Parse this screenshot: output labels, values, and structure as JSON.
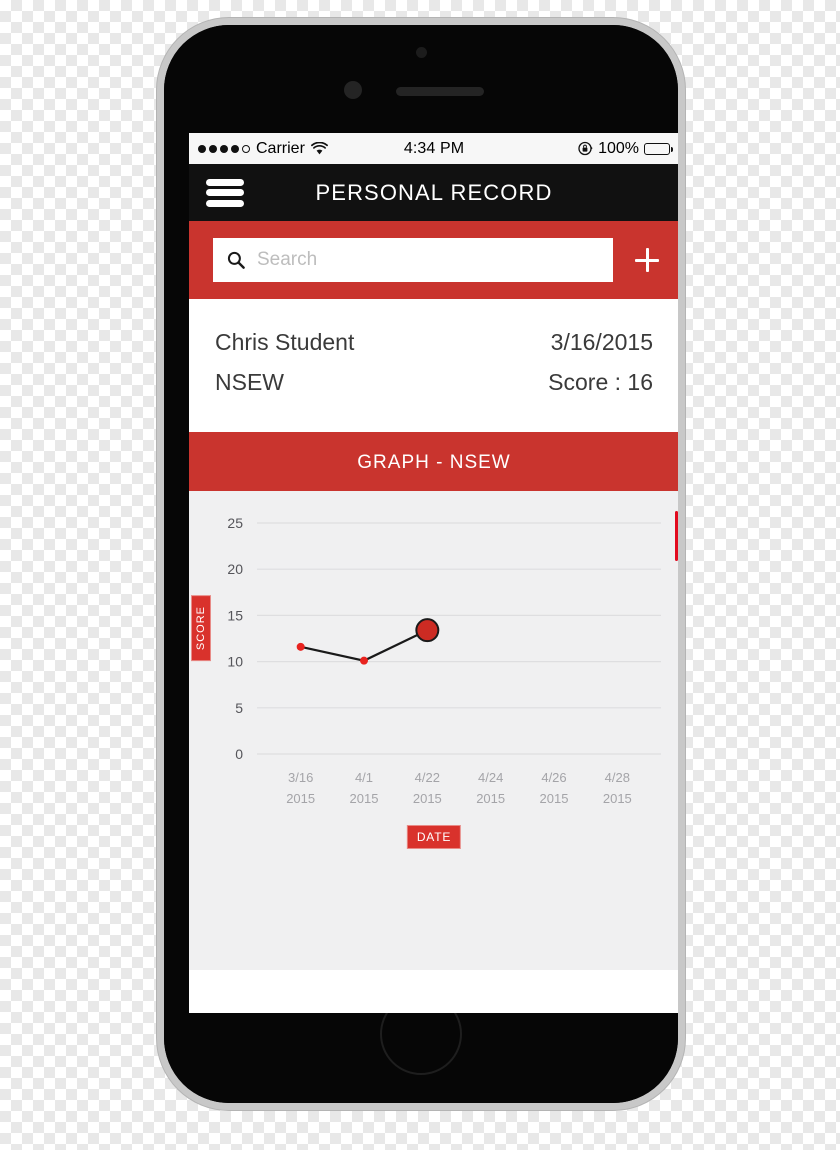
{
  "device": {
    "name": "iphone-mockup",
    "frame_color": "#c8c8c8",
    "body_color": "#0a0a0a"
  },
  "status_bar": {
    "signal_dots_filled": 4,
    "signal_dots_total": 5,
    "carrier": "Carrier",
    "wifi_icon": "wifi-icon",
    "time": "4:34 PM",
    "rotation_lock_icon": "rotation-lock-icon",
    "battery_percent": "100%",
    "battery_level": 100
  },
  "nav": {
    "menu_icon": "hamburger-menu-icon",
    "title": "PERSONAL RECORD"
  },
  "search": {
    "icon": "search-icon",
    "placeholder": "Search",
    "value": "",
    "add_icon": "plus-icon",
    "bar_color": "#c9342e"
  },
  "record": {
    "student_name": "Chris Student",
    "date": "3/16/2015",
    "test_name": "NSEW",
    "score_label": "Score : 16"
  },
  "graph_header": {
    "title": "GRAPH - NSEW"
  },
  "chart_data": {
    "type": "line",
    "title": "GRAPH - NSEW",
    "xlabel": "DATE",
    "ylabel": "SCORE",
    "x_tick_labels": [
      "3/16\n2015",
      "4/1\n2015",
      "4/22\n2015",
      "4/24\n2015",
      "4/26\n2015",
      "4/28\n2015"
    ],
    "x_tick_lines": [
      [
        "3/16",
        "2015"
      ],
      [
        "4/1",
        "2015"
      ],
      [
        "4/22",
        "2015"
      ],
      [
        "4/24",
        "2015"
      ],
      [
        "4/26",
        "2015"
      ],
      [
        "4/28",
        "2015"
      ]
    ],
    "categories": [
      "3/16/2015",
      "4/1/2015",
      "4/22/2015",
      "4/24/2015",
      "4/26/2015",
      "4/28/2015"
    ],
    "y_ticks": [
      0,
      5,
      10,
      15,
      20,
      25
    ],
    "ylim": [
      0,
      26.5
    ],
    "grid": true,
    "legend": false,
    "series": [
      {
        "name": "Score",
        "color": "#e8231f",
        "line_color": "#1a1a1a",
        "points": [
          {
            "x": "3/16/2015",
            "value": 11.6,
            "highlighted": false
          },
          {
            "x": "4/1/2015",
            "value": 10.1,
            "highlighted": false
          },
          {
            "x": "4/22/2015",
            "value": 13.4,
            "highlighted": true
          }
        ],
        "values": [
          11.6,
          10.1,
          13.4,
          null,
          null,
          null
        ]
      }
    ]
  },
  "axis_badges": {
    "y_badge": "SCORE",
    "x_badge": "DATE",
    "badge_color": "#d9322c"
  },
  "colors": {
    "accent_red": "#c9342e",
    "badge_red": "#d9322c",
    "nav_black": "#111111",
    "chart_bg": "#f0f0f1",
    "scroll_indicator": "#e20a1e"
  }
}
